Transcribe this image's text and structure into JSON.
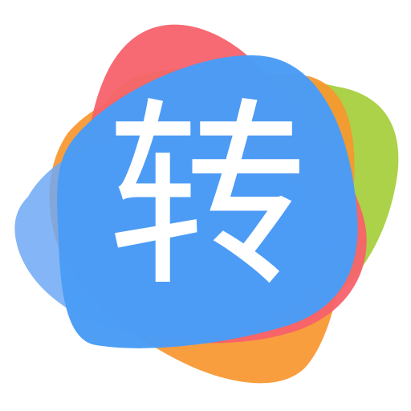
{
  "app_icon": {
    "glyph": "转",
    "colors": {
      "background": "#ffffff",
      "petal_red": "#f7626b",
      "petal_orange": "#f7962f",
      "petal_green": "#a4ce38",
      "petal_blue_light": "#6ea8f4",
      "petal_blue_main": "#4a9cf6",
      "glyph": "#ffffff"
    }
  }
}
